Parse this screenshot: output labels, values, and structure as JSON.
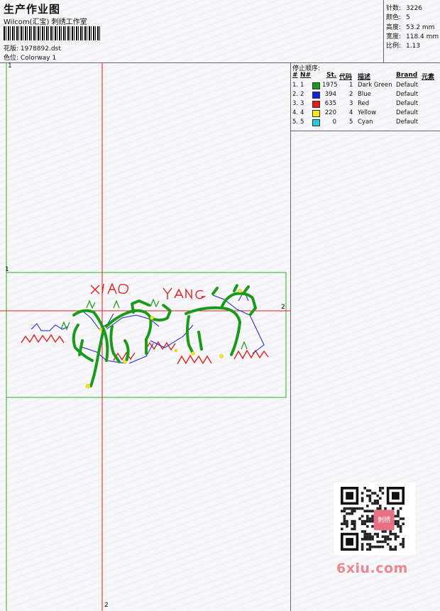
{
  "header": {
    "title": "生产作业图",
    "company": "Wilcom(汇宝) 刺绣工作室",
    "design_label": "花版: 1978892.dst",
    "colorway_label": "色位:  Colorway 1"
  },
  "stats": [
    {
      "label": "针数:",
      "value": "3226"
    },
    {
      "label": "颜色:",
      "value": "5"
    },
    {
      "label": "高度:",
      "value": "53.2 mm"
    },
    {
      "label": "宽度:",
      "value": "118.4 mm"
    },
    {
      "label": "比例:",
      "value": "1.13"
    }
  ],
  "color_panel": {
    "title": "停止顺序:",
    "headers": {
      "num": "#",
      "no": "N#",
      "st": "St.",
      "code": "代码",
      "desc": "描述",
      "brand": "Brand",
      "elem": "元素"
    },
    "rows": [
      {
        "num": "1.",
        "no": "1",
        "st": "1975",
        "code": "1",
        "desc": "Dark Green",
        "brand": "Default",
        "color": "#1a9a1a"
      },
      {
        "num": "2.",
        "no": "2",
        "st": "394",
        "code": "2",
        "desc": "Blue",
        "brand": "Default",
        "color": "#1424d8"
      },
      {
        "num": "3.",
        "no": "3",
        "st": "635",
        "code": "3",
        "desc": "Red",
        "brand": "Default",
        "color": "#e81818"
      },
      {
        "num": "4.",
        "no": "4",
        "st": "220",
        "code": "4",
        "desc": "Yellow",
        "brand": "Default",
        "color": "#f4e81a"
      },
      {
        "num": "5.",
        "no": "5",
        "st": "0",
        "code": "5",
        "desc": "Cyan",
        "brand": "Default",
        "color": "#20d0d8"
      }
    ]
  },
  "canvas": {
    "axis_marks": [
      "1",
      "1",
      "2",
      "2"
    ],
    "embroidery_text": "XIAO YANG"
  },
  "watermark": "6xiu.com",
  "qr_badge": "刺绣"
}
